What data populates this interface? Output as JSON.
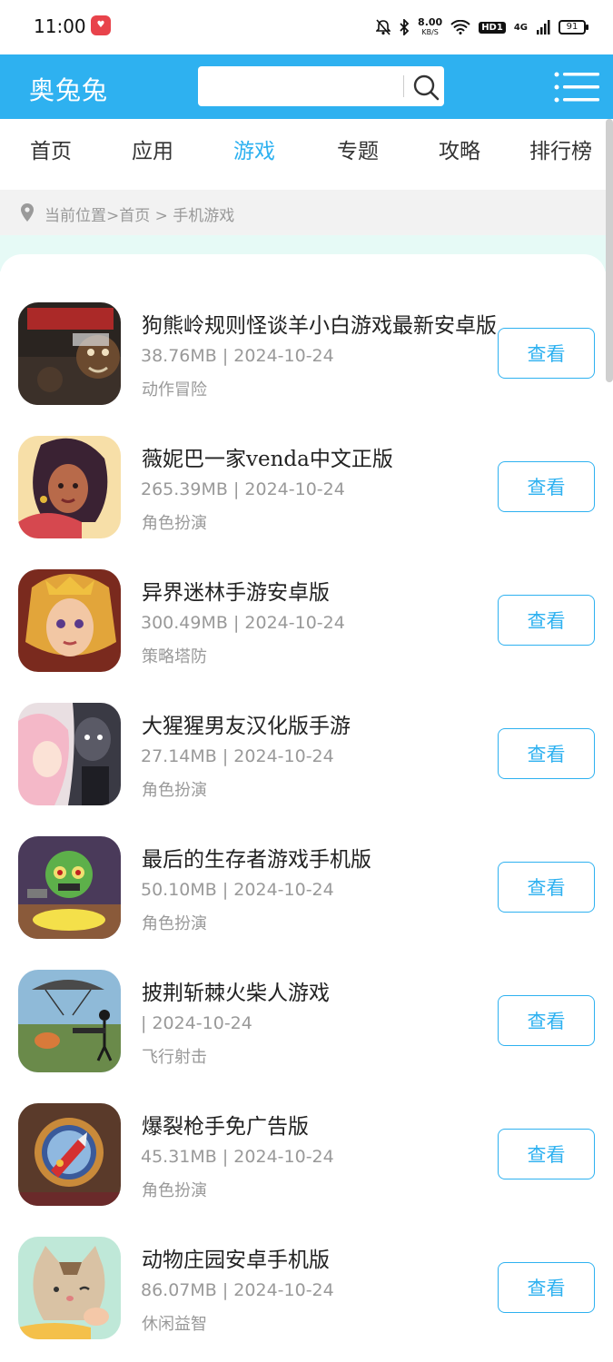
{
  "status_bar": {
    "time": "11:00",
    "speed_value": "8.00",
    "speed_unit": "KB/S",
    "hd": "HD1",
    "network": "4G",
    "battery": "91"
  },
  "header": {
    "logo": "奥兔兔",
    "search_placeholder": "",
    "brand_color": "#2eb1f0"
  },
  "nav": {
    "tabs": [
      {
        "label": "首页",
        "active": false
      },
      {
        "label": "应用",
        "active": false
      },
      {
        "label": "游戏",
        "active": true
      },
      {
        "label": "专题",
        "active": false
      },
      {
        "label": "攻略",
        "active": false
      },
      {
        "label": "排行榜",
        "active": false
      }
    ]
  },
  "breadcrumb": {
    "text": "当前位置>首页 > 手机游戏"
  },
  "games": [
    {
      "title": "狗熊岭规则怪谈羊小白游戏最新安卓版",
      "meta": "38.76MB | 2024-10-24",
      "category": "动作冒险",
      "button": "查看",
      "icon": "game-icon-bear-ridge"
    },
    {
      "title": "薇妮巴一家venda中文正版",
      "meta": "265.39MB | 2024-10-24",
      "category": "角色扮演",
      "button": "查看",
      "icon": "game-icon-venda"
    },
    {
      "title": "异界迷林手游安卓版",
      "meta": "300.49MB | 2024-10-24",
      "category": "策略塔防",
      "button": "查看",
      "icon": "game-icon-otherworld-forest"
    },
    {
      "title": "大猩猩男友汉化版手游",
      "meta": "27.14MB | 2024-10-24",
      "category": "角色扮演",
      "button": "查看",
      "icon": "game-icon-gorilla-boyfriend"
    },
    {
      "title": "最后的生存者游戏手机版",
      "meta": "50.10MB | 2024-10-24",
      "category": "角色扮演",
      "button": "查看",
      "icon": "game-icon-last-survivor"
    },
    {
      "title": "披荆斩棘火柴人游戏",
      "meta": " | 2024-10-24",
      "category": "飞行射击",
      "button": "查看",
      "icon": "game-icon-stickman"
    },
    {
      "title": "爆裂枪手免广告版",
      "meta": "45.31MB | 2024-10-24",
      "category": "角色扮演",
      "button": "查看",
      "icon": "game-icon-burst-gunner"
    },
    {
      "title": "动物庄园安卓手机版",
      "meta": "86.07MB | 2024-10-24",
      "category": "休闲益智",
      "button": "查看",
      "icon": "game-icon-animal-farm"
    }
  ]
}
